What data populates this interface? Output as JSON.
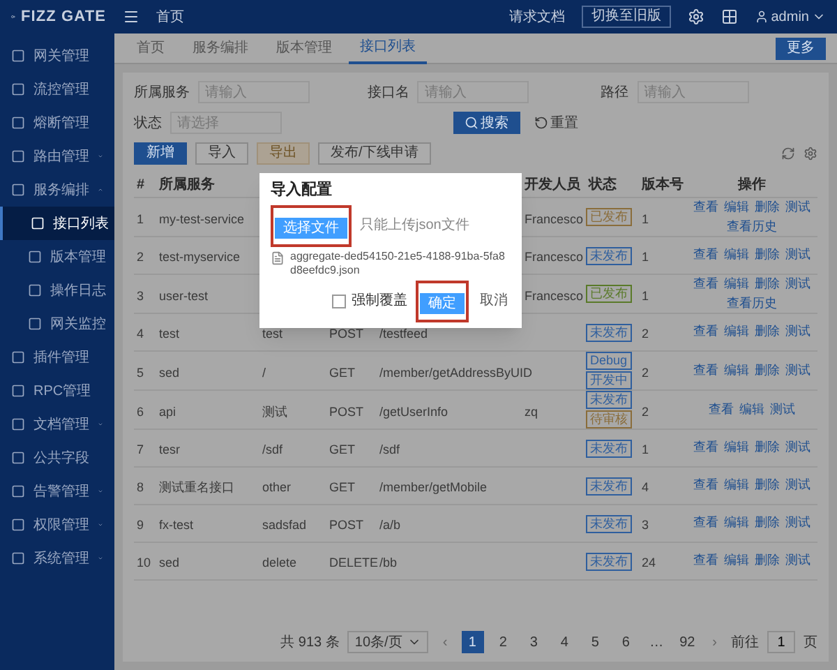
{
  "header": {
    "logo": "FIZZ GATE",
    "breadcrumb": "首页",
    "link": "请求文档",
    "button": "切换至旧版",
    "user": "admin"
  },
  "sidebar": {
    "items": [
      {
        "label": "网关管理",
        "selected": false
      },
      {
        "label": "流控管理",
        "selected": false
      },
      {
        "label": "熔断管理",
        "selected": false
      },
      {
        "label": "路由管理",
        "selected": false,
        "expanded": false
      },
      {
        "label": "服务编排",
        "selected": false,
        "expanded": true,
        "children": [
          {
            "label": "接口列表",
            "selected": true
          },
          {
            "label": "版本管理",
            "selected": false
          },
          {
            "label": "操作日志",
            "selected": false
          },
          {
            "label": "网关监控",
            "selected": false
          }
        ]
      },
      {
        "label": "插件管理",
        "selected": false
      },
      {
        "label": "RPC管理",
        "selected": false
      },
      {
        "label": "文档管理",
        "selected": false,
        "expanded": false
      },
      {
        "label": "公共字段",
        "selected": false
      },
      {
        "label": "告警管理",
        "selected": false,
        "expanded": false
      },
      {
        "label": "权限管理",
        "selected": false,
        "expanded": false
      },
      {
        "label": "系统管理",
        "selected": false,
        "expanded": false
      }
    ]
  },
  "tabs": [
    {
      "label": "首页",
      "selected": false
    },
    {
      "label": "服务编排",
      "selected": false
    },
    {
      "label": "版本管理",
      "selected": false
    },
    {
      "label": "接口列表",
      "selected": true
    }
  ],
  "more_button": "更多",
  "filters": [
    {
      "label": "所属服务",
      "placeholder": "请输入"
    },
    {
      "label": "接口名",
      "placeholder": "请输入"
    },
    {
      "label": "路径",
      "placeholder": "请输入"
    },
    {
      "label": "状态",
      "placeholder": "请选择"
    }
  ],
  "search_button": "搜索",
  "reset_button": "重置",
  "toolbar": [
    {
      "label": "新增",
      "kind": "primary"
    },
    {
      "label": "导入",
      "kind": "plain"
    },
    {
      "label": "导出",
      "kind": "warning"
    },
    {
      "label": "发布/下线申请",
      "kind": "plain"
    }
  ],
  "table": {
    "columns": [
      "#",
      "所属服务",
      "开发人员",
      "状态",
      "版本号",
      "操作"
    ],
    "rows": [
      {
        "number": "1",
        "service": "my-test-service",
        "developer": "Francesco",
        "status": [
          {
            "label": "已发布",
            "color": "#8a6d3b"
          }
        ],
        "version": "1",
        "actions": [
          "查看",
          "编辑",
          "删除",
          "测试",
          "查看历史"
        ]
      },
      {
        "number": "2",
        "service": "test-myservice",
        "developer": "Francesco",
        "status": [
          {
            "label": "未发布",
            "color": "#2f5f9e"
          }
        ],
        "version": "1",
        "actions": [
          "查看",
          "编辑",
          "删除",
          "测试"
        ]
      },
      {
        "number": "3",
        "service": "user-test",
        "developer": "Francesco",
        "status": [
          {
            "label": "已发布",
            "color": "#5a7a2a"
          }
        ],
        "version": "1",
        "actions": [
          "查看",
          "编辑",
          "删除",
          "测试",
          "查看历史"
        ]
      },
      {
        "number": "4",
        "service": "test",
        "name": "test",
        "method": "POST",
        "path": "/testfeed",
        "status": [
          {
            "label": "未发布",
            "color": "#2f5f9e"
          }
        ],
        "version": "2",
        "actions": [
          "查看",
          "编辑",
          "删除",
          "测试"
        ]
      },
      {
        "number": "5",
        "service": "sed",
        "name": "/",
        "method": "GET",
        "path": "/member/getAddressByUID",
        "status": [
          {
            "label": "Debug",
            "color": "#2f5f9e"
          },
          {
            "label": "开发中",
            "color": "#2f5f9e"
          }
        ],
        "version": "2",
        "actions": [
          "查看",
          "编辑",
          "删除",
          "测试"
        ]
      },
      {
        "number": "6",
        "service": "api",
        "name": "测试",
        "method": "POST",
        "path": "/getUserInfo",
        "developer": "zq",
        "status": [
          {
            "label": "未发布",
            "color": "#2f5f9e"
          },
          {
            "label": "待审核",
            "color": "#8a6d3b"
          }
        ],
        "version": "2",
        "actions": [
          "查看",
          "编辑",
          "测试"
        ]
      },
      {
        "number": "7",
        "service": "tesr",
        "name": "/sdf",
        "method": "GET",
        "path": "/sdf",
        "status": [
          {
            "label": "未发布",
            "color": "#2f5f9e"
          }
        ],
        "version": "1",
        "actions": [
          "查看",
          "编辑",
          "删除",
          "测试"
        ]
      },
      {
        "number": "8",
        "service": "测试重名接口",
        "name": "other",
        "method": "GET",
        "path": "/member/getMobile",
        "status": [
          {
            "label": "未发布",
            "color": "#2f5f9e"
          }
        ],
        "version": "4",
        "actions": [
          "查看",
          "编辑",
          "删除",
          "测试"
        ]
      },
      {
        "number": "9",
        "service": "fx-test",
        "name": "sadsfad",
        "method": "POST",
        "path": "/a/b",
        "status": [
          {
            "label": "未发布",
            "color": "#2f5f9e"
          }
        ],
        "version": "3",
        "actions": [
          "查看",
          "编辑",
          "删除",
          "测试"
        ]
      },
      {
        "number": "10",
        "service": "sed",
        "name": "delete",
        "method": "DELETE",
        "path": "/bb",
        "status": [
          {
            "label": "未发布",
            "color": "#2f5f9e"
          }
        ],
        "version": "24",
        "actions": [
          "查看",
          "编辑",
          "删除",
          "测试"
        ]
      }
    ]
  },
  "pagination": {
    "total": "共 913 条",
    "page_size": "10条/页",
    "prev": "‹",
    "pages": [
      {
        "label": "1",
        "selected": true
      },
      {
        "label": "2",
        "selected": false
      },
      {
        "label": "3",
        "selected": false
      },
      {
        "label": "4",
        "selected": false
      },
      {
        "label": "5",
        "selected": false
      },
      {
        "label": "6",
        "selected": false
      },
      {
        "label": "…",
        "selected": false
      },
      {
        "label": "92",
        "selected": false
      }
    ],
    "next": "›",
    "goto": "前往",
    "goto_value": "1",
    "goto_unit": "页"
  },
  "dialog": {
    "title": "导入配置",
    "file_button": "选择文件",
    "hint": "只能上传json文件",
    "file": "aggregate-ded54150-21e5-4188-91ba-5fa8d8eefdc9.json",
    "force": {
      "label": "强制覆盖",
      "checked": false
    },
    "ok": "确定",
    "cancel": "取消"
  }
}
